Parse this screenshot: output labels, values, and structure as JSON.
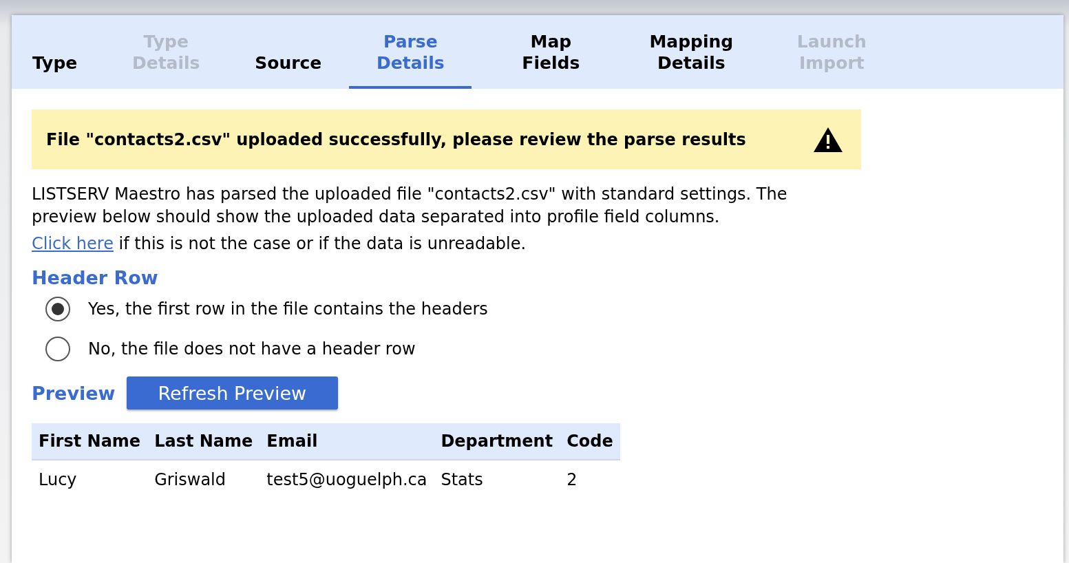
{
  "tabs": [
    {
      "label": "Type",
      "selected": false,
      "disabled": false
    },
    {
      "label": "Type Details",
      "selected": false,
      "disabled": true
    },
    {
      "label": "Source",
      "selected": false,
      "disabled": false
    },
    {
      "label": "Parse Details",
      "selected": true,
      "disabled": false
    },
    {
      "label": "Map Fields",
      "selected": false,
      "disabled": false
    },
    {
      "label": "Mapping Details",
      "selected": false,
      "disabled": false
    },
    {
      "label": "Launch Import",
      "selected": false,
      "disabled": true
    }
  ],
  "banner": {
    "message": "File \"contacts2.csv\" uploaded successfully, please review the parse results"
  },
  "description": "LISTSERV Maestro has parsed the uploaded file \"contacts2.csv\" with standard settings. The preview below should show the uploaded data separated into profile field columns.",
  "help": {
    "link": "Click here",
    "text": "if this is not the case or if the data is unreadable."
  },
  "header_row": {
    "title": "Header Row",
    "options": [
      {
        "label": "Yes, the first row in the file contains the headers",
        "selected": true
      },
      {
        "label": "No, the file does not have a header row",
        "selected": false
      }
    ]
  },
  "preview": {
    "title": "Preview",
    "button": "Refresh Preview"
  },
  "table": {
    "columns": [
      "First Name",
      "Last Name",
      "Email",
      "Department",
      "Code"
    ],
    "rows": [
      [
        "Lucy",
        "Griswald",
        "test5@uoguelph.ca",
        "Stats",
        "2"
      ]
    ]
  }
}
